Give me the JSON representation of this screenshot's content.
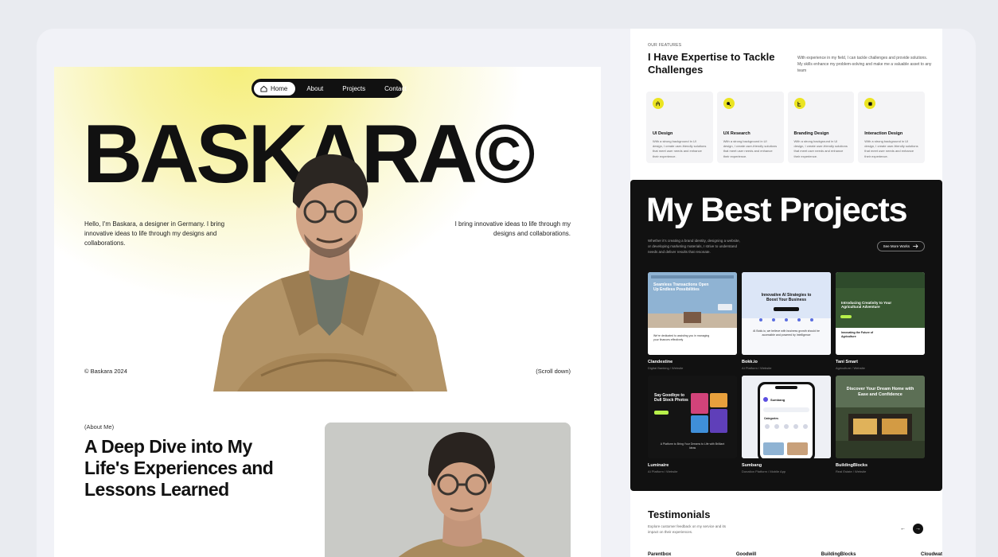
{
  "nav": {
    "items": [
      {
        "label": "Home",
        "active": true
      },
      {
        "label": "About",
        "active": false
      },
      {
        "label": "Projects",
        "active": false
      },
      {
        "label": "Contact",
        "active": false
      }
    ]
  },
  "hero": {
    "title": "BASKARA©",
    "intro_left": "Hello, I'm Baskara, a designer in Germany. I bring innovative ideas to life through my designs and collaborations.",
    "intro_right": "I bring innovative ideas to life through my designs and collaborations.",
    "copyright": "© Baskara 2024",
    "scroll": "(Scroll down)"
  },
  "about": {
    "label": "(About Me)",
    "heading": "A Deep Dive into My Life's Experiences and Lessons Learned"
  },
  "features": {
    "label": "OUR FEATURES",
    "heading": "I Have Expertise to Tackle Challenges",
    "description": "With experience in my field, I can tackle challenges and provide solutions. My skills enhance my problem-solving and make me a valuable asset to any team",
    "cards": [
      {
        "title": "UI Design",
        "text": "With a strong background in UI design, I create user-friendly solutions that meet user needs and enhance their experience.",
        "icon": "pen-icon"
      },
      {
        "title": "UX Research",
        "text": "With a strong background in UI design, I create user-friendly solutions that meet user needs and enhance their experience.",
        "icon": "search-icon"
      },
      {
        "title": "Branding Design",
        "text": "With a strong background in UI design, I create user-friendly solutions that meet user needs and enhance their experience.",
        "icon": "brand-icon"
      },
      {
        "title": "Interaction Design",
        "text": "With a strong background in UI design, I create user-friendly solutions that meet user needs and enhance their experience.",
        "icon": "interaction-icon"
      }
    ]
  },
  "projects": {
    "title": "My Best Projects",
    "description": "Whether it's creating a brand identity, designing a website, or developing marketing materials, I strive to understand needs and deliver results that resonate.",
    "see_more": "See More Works",
    "items": [
      {
        "name": "Clandestine",
        "meta": "Digital Banking / Website",
        "thumb_heading": "Seamless Transactions Open Up Endless Possibilities",
        "thumb_sub": "We're dedicated to assisting you in managing your finances effectively"
      },
      {
        "name": "Bokk.io",
        "meta": "AI Platform / Website",
        "thumb_heading": "Innovative AI Strategies to Boost Your Business",
        "thumb_sub": "AI Bokk.io, we believe with business growth should be accessible and powered by Intelligence"
      },
      {
        "name": "Tani Smart",
        "meta": "Agriculture / Website",
        "thumb_heading": "Introducing Creativity to Your Agricultural Adventure",
        "thumb_sub": "Innovating the Future of Agriculture"
      },
      {
        "name": "Luminaire",
        "meta": "AI Platform / Website",
        "thumb_heading": "Say Goodbye to Dull Stock Photos",
        "thumb_sub": "A Platform to Bring Your Dreams to Life with Brilliant Ideas"
      },
      {
        "name": "Sumbang",
        "meta": "Donation Platform / Mobile App",
        "thumb_heading": "Sumbang",
        "thumb_sub": "Categories"
      },
      {
        "name": "BuildingBlocks",
        "meta": "Real Estate / Website",
        "thumb_heading": "Discover Your Dream Home with Ease and Confidence",
        "thumb_sub": ""
      }
    ]
  },
  "testimonials": {
    "title": "Testimonials",
    "description": "Explore customer feedback on my service and its impact on their experiences.",
    "logos": [
      "Parentbox",
      "Goodwill",
      "BuildingBlocks",
      "Cloudwat"
    ]
  },
  "colors": {
    "accent": "#ebe422",
    "dark": "#111111"
  }
}
